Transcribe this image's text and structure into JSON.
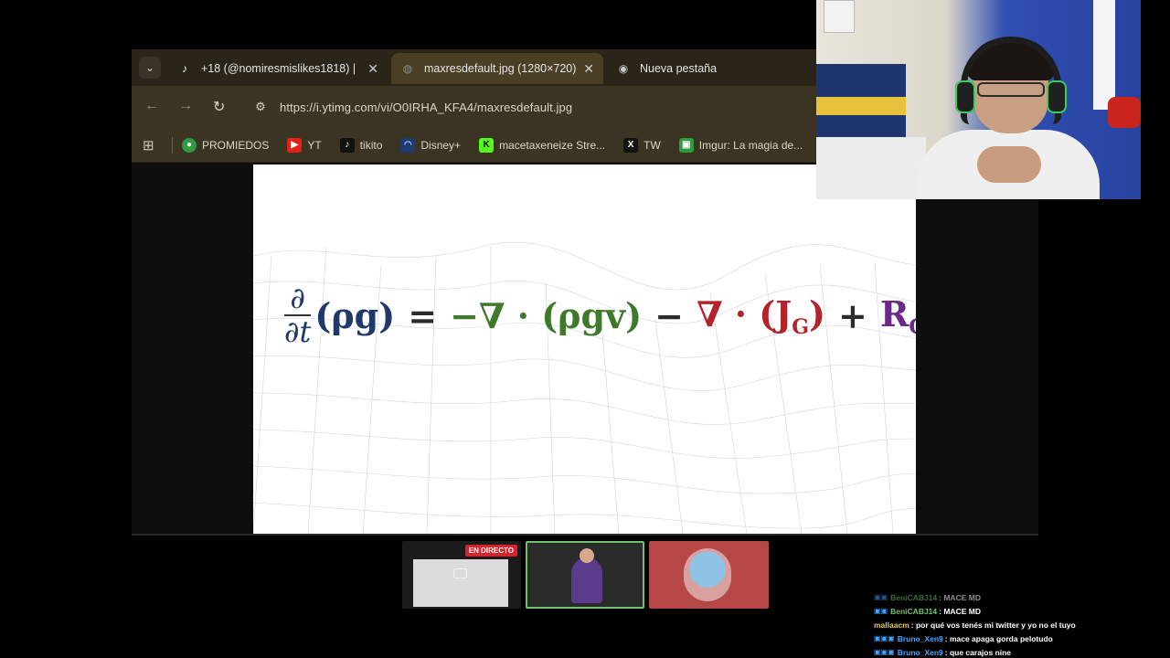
{
  "browser": {
    "tabs": [
      {
        "label": "+18 (@nomiresmislikes1818) |",
        "icon": "tiktok-icon",
        "active": false
      },
      {
        "label": "maxresdefault.jpg (1280×720)",
        "icon": "globe-icon",
        "active": true
      },
      {
        "label": "Nueva pestaña",
        "icon": "chrome-icon",
        "active": false
      }
    ],
    "url": "https://i.ytimg.com/vi/O0IRHA_KFA4/maxresdefault.jpg",
    "bookmarks": [
      {
        "label": "PROMIEDOS",
        "icon": "promiedos-icon",
        "color": "#2f9a3f"
      },
      {
        "label": "YT",
        "icon": "youtube-icon",
        "color": "#e62117"
      },
      {
        "label": "tikito",
        "icon": "tiktok-icon",
        "color": "#111111"
      },
      {
        "label": "Disney+",
        "icon": "disney-icon",
        "color": "#1f3a6e"
      },
      {
        "label": "macetaxeneize Stre...",
        "icon": "kick-icon",
        "color": "#53fc18"
      },
      {
        "label": "TW",
        "icon": "x-icon",
        "color": "#111111"
      },
      {
        "label": "Imgur: La magia de...",
        "icon": "imgur-icon",
        "color": "#2f9a3f"
      }
    ]
  },
  "equation": {
    "frac_num": "∂",
    "frac_den": "∂t",
    "lhs": "(ρg)",
    "equals": "=",
    "term1": "−∇ · (ρgv)",
    "minus": "−",
    "term2": "∇ · (J",
    "term2_sub": "G",
    "term2_close": ")",
    "plus": "+",
    "term3": "R",
    "term3_sub": "G"
  },
  "scenes": {
    "live_badge": "EN DIRECTO"
  },
  "chat": [
    {
      "user": "BeniCABJ14",
      "message": ": MACE MD",
      "user_color": "#6ec36b",
      "badges": "▣▣",
      "faded": true
    },
    {
      "user": "BeniCABJ14",
      "message": ": MACE MD",
      "user_color": "#6ec36b",
      "badges": "▣▣",
      "faded": false
    },
    {
      "user": "mallaacm",
      "message": ": por qué vos tenés mi twitter y yo no el tuyo",
      "user_color": "#e6c84a",
      "badges": "",
      "faded": false
    },
    {
      "user": "Bruno_Xen9",
      "message": ": mace apaga gorda pelotudo",
      "user_color": "#4aa3ff",
      "badges": "▣▣▣",
      "faded": false
    },
    {
      "user": "Bruno_Xen9",
      "message": ": que carajos nine",
      "user_color": "#4aa3ff",
      "badges": "▣▣▣",
      "faded": false
    }
  ]
}
